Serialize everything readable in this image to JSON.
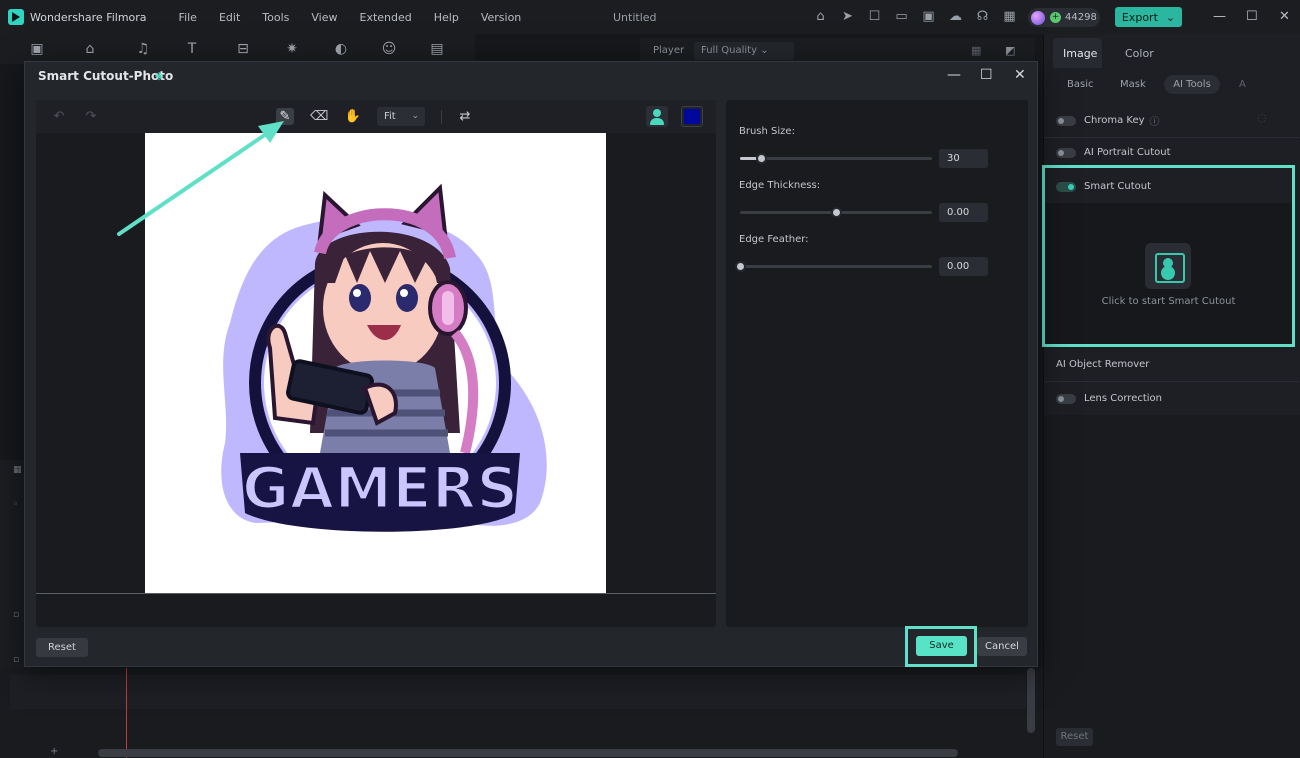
{
  "app": {
    "name": "Wondershare Filmora",
    "document_title": "Untitled",
    "menu": [
      "File",
      "Edit",
      "Tools",
      "View",
      "Extended",
      "Help",
      "Version"
    ],
    "credits": "44298",
    "export_label": "Export"
  },
  "player": {
    "label": "Player",
    "quality": "Full Quality"
  },
  "right_panel": {
    "tabs": [
      "Image",
      "Color"
    ],
    "subtabs": [
      "Basic",
      "Mask",
      "AI Tools",
      "A"
    ],
    "chroma_key": "Chroma Key",
    "ai_portrait": "AI Portrait Cutout",
    "smart_cutout": "Smart Cutout",
    "smart_cutout_hint": "Click to start Smart Cutout",
    "ai_object_remover": "AI Object Remover",
    "lens_correction": "Lens Correction",
    "reset": "Reset"
  },
  "dialog": {
    "title": "Smart Cutout-Photo",
    "zoom": "Fit",
    "brush_color": "#00079c",
    "settings": {
      "brush_size_label": "Brush Size:",
      "brush_size_value": "30",
      "brush_size_fraction": 0.11,
      "edge_thickness_label": "Edge Thickness:",
      "edge_thickness_value": "0.00",
      "edge_thickness_fraction": 0.5,
      "edge_feather_label": "Edge Feather:",
      "edge_feather_value": "0.00",
      "edge_feather_fraction": 0.0
    },
    "reset_label": "Reset",
    "save_label": "Save",
    "cancel_label": "Cancel"
  },
  "image": {
    "logo_text": "GAMERS"
  },
  "colors": {
    "accent": "#5fe0c7",
    "highlight": "#5fe0c7"
  }
}
